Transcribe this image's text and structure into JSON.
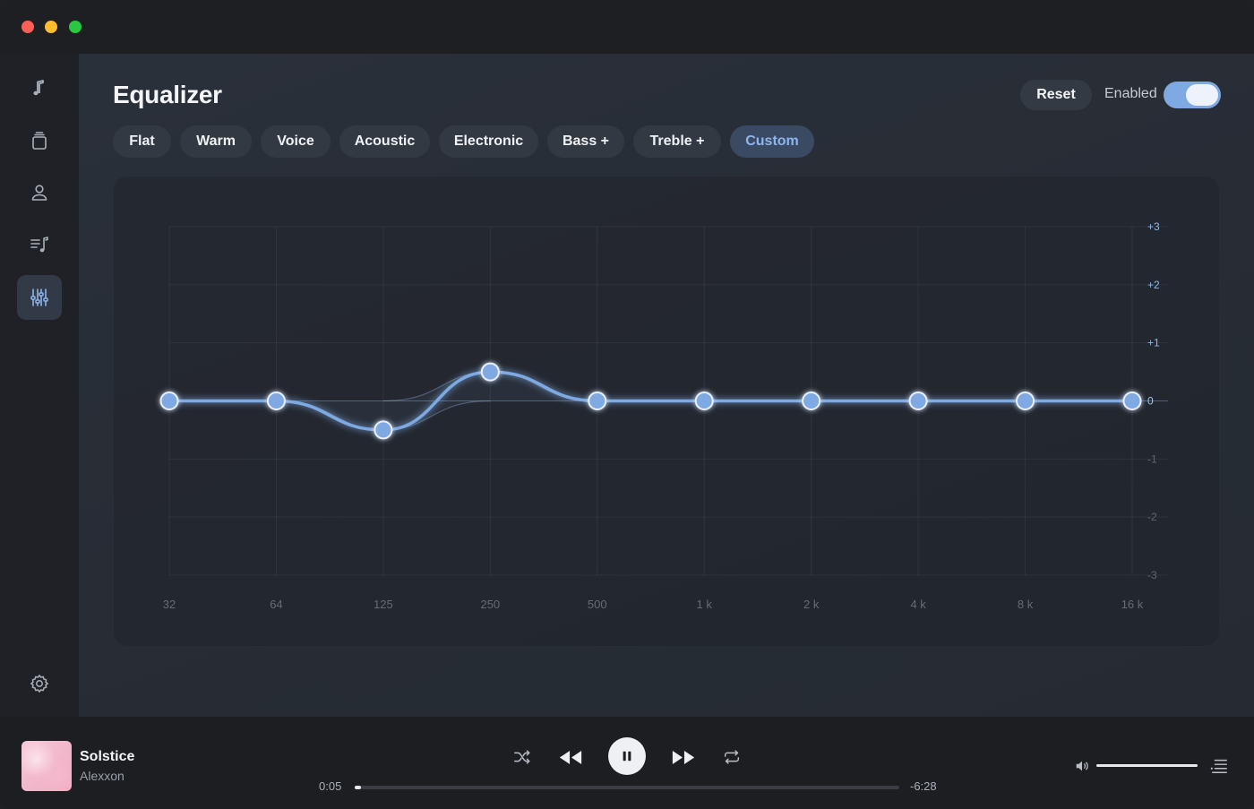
{
  "window": {
    "controls": [
      "close",
      "minimize",
      "zoom"
    ]
  },
  "sidebar": {
    "items": [
      {
        "name": "songs",
        "icon": "music-note-icon",
        "active": false
      },
      {
        "name": "albums",
        "icon": "albums-stack-icon",
        "active": false
      },
      {
        "name": "artists",
        "icon": "person-icon",
        "active": false
      },
      {
        "name": "playlists",
        "icon": "playlist-icon",
        "active": false
      },
      {
        "name": "equalizer",
        "icon": "sliders-icon",
        "active": true
      }
    ],
    "settings_icon": "gear-icon"
  },
  "header": {
    "title": "Equalizer",
    "reset_label": "Reset",
    "enabled_label": "Enabled",
    "enabled": true
  },
  "presets": [
    {
      "label": "Flat",
      "active": false
    },
    {
      "label": "Warm",
      "active": false
    },
    {
      "label": "Voice",
      "active": false
    },
    {
      "label": "Acoustic",
      "active": false
    },
    {
      "label": "Electronic",
      "active": false
    },
    {
      "label": "Bass +",
      "active": false
    },
    {
      "label": "Treble +",
      "active": false
    },
    {
      "label": "Custom",
      "active": true
    }
  ],
  "chart_data": {
    "type": "line",
    "x": [
      "32",
      "64",
      "125",
      "250",
      "500",
      "1 k",
      "2 k",
      "4 k",
      "8 k",
      "16 k"
    ],
    "series": [
      {
        "values": [
          0,
          0,
          -0.5,
          0.5,
          0,
          0,
          0,
          0,
          0,
          0
        ]
      }
    ],
    "y_ticks": [
      "+3",
      "+2",
      "+1",
      "0",
      "-1",
      "-2",
      "-3"
    ],
    "ylim": [
      -3,
      3
    ],
    "grid": true,
    "accent_color": "#7ea9e2"
  },
  "player": {
    "track_title": "Solstice",
    "artist": "Alexxon",
    "elapsed": "0:05",
    "remaining": "-6:28",
    "progress": 0.012,
    "volume": 1.0,
    "state": "playing",
    "controls": {
      "shuffle_icon": "shuffle-icon",
      "previous_icon": "rewind-icon",
      "pause_icon": "pause-icon",
      "next_icon": "fast-forward-icon",
      "repeat_icon": "repeat-icon",
      "volume_icon": "speaker-icon",
      "queue_icon": "queue-list-icon"
    }
  }
}
